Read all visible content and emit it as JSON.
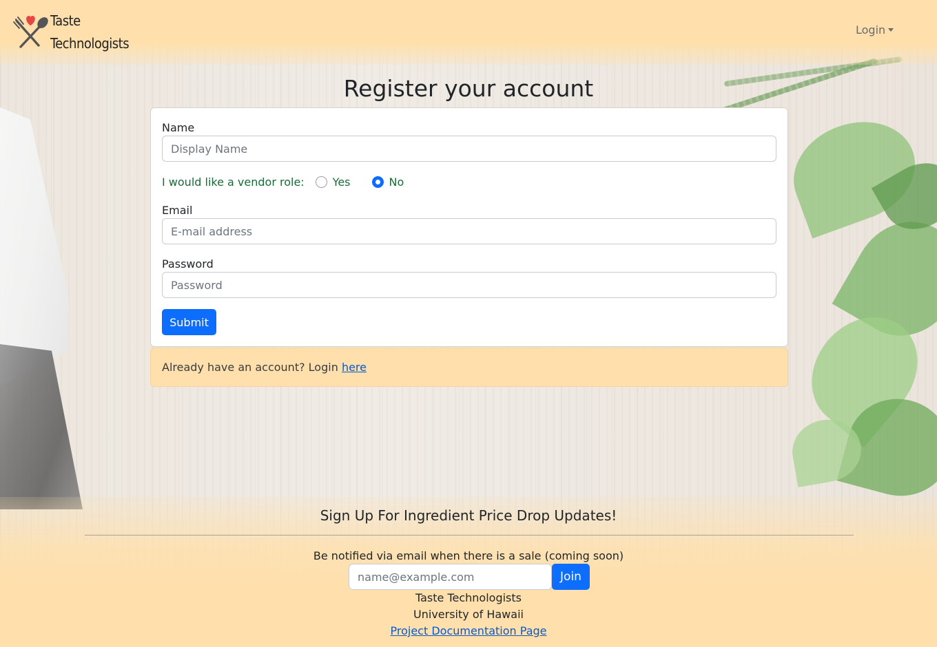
{
  "navbar": {
    "brand_line1": "Taste",
    "brand_line2": "Technologists",
    "login_menu": "Login"
  },
  "page": {
    "title": "Register your account"
  },
  "form": {
    "name_label": "Name",
    "name_placeholder": "Display Name",
    "name_value": "",
    "vendor_label": "I would like a vendor role:",
    "vendor_options": [
      {
        "label": "Yes",
        "selected": false
      },
      {
        "label": "No",
        "selected": true
      }
    ],
    "email_label": "Email",
    "email_placeholder": "E-mail address",
    "email_value": "",
    "password_label": "Password",
    "password_placeholder": "Password",
    "password_value": "",
    "submit_label": "Submit"
  },
  "alert": {
    "text": "Already have an account? Login",
    "link_text": "here"
  },
  "footer": {
    "title": "Sign Up For Ingredient Price Drop Updates!",
    "note": "Be notified via email when there is a sale (coming soon)",
    "email_placeholder": "name@example.com",
    "join_label": "Join",
    "org_name": "Taste Technologists",
    "university": "University of Hawaii",
    "doc_link": "Project Documentation Page"
  },
  "colors": {
    "navbar_bg": "#ffe0ac",
    "primary": "#0d6efd",
    "vendor_text": "#1a6b38",
    "link": "#0a58ca"
  },
  "icons": {
    "logo": "fork-spoon-heart-icon",
    "caret": "caret-down-icon"
  }
}
